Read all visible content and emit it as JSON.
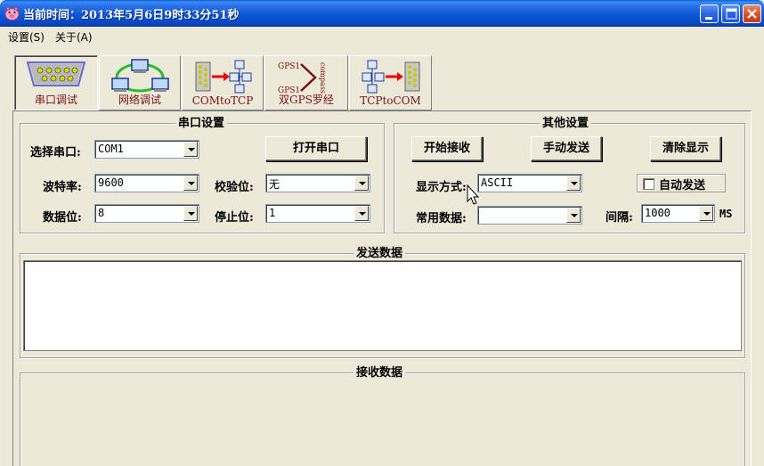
{
  "window": {
    "title": "当前时间：2013年5月6日9时33分51秒"
  },
  "menu": {
    "items": [
      "设置(S)",
      "关于(A)"
    ]
  },
  "tools": [
    {
      "label": "串口调试",
      "icon": "serial-port-icon",
      "active": true
    },
    {
      "label": "网络调试",
      "icon": "network-icon",
      "active": false
    },
    {
      "label": "COMtoTCP",
      "icon": "com-to-tcp-icon",
      "active": false
    },
    {
      "label": "双GPS罗经",
      "icon": "gps-compass-icon",
      "active": false
    },
    {
      "label": "TCPtoCOM",
      "icon": "tcp-to-com-icon",
      "active": false
    }
  ],
  "gps_icon_text": {
    "top": "GPS1",
    "bottom": "GPS1",
    "side": "compass"
  },
  "serial_settings": {
    "title": "串口设置",
    "port_label": "选择串口:",
    "port_value": "COM1",
    "open_button": "打开串口",
    "baud_label": "波特率:",
    "baud_value": "9600",
    "parity_label": "校验位:",
    "parity_value": "无",
    "databits_label": "数据位:",
    "databits_value": "8",
    "stopbits_label": "停止位:",
    "stopbits_value": "1"
  },
  "other_settings": {
    "title": "其他设置",
    "start_receive": "开始接收",
    "manual_send": "手动发送",
    "clear_display": "清除显示",
    "display_mode_label": "显示方式:",
    "display_mode_value": "ASCII",
    "auto_send_label": "自动发送",
    "common_data_label": "常用数据:",
    "common_data_value": "",
    "interval_label": "间隔:",
    "interval_value": "1000",
    "interval_unit": "MS"
  },
  "send_group": {
    "title": "发送数据"
  },
  "receive_group": {
    "title": "接收数据"
  },
  "colors": {
    "titlebar": "#0a55d6",
    "face": "#ece9d8",
    "tab_text": "#7b1010"
  }
}
